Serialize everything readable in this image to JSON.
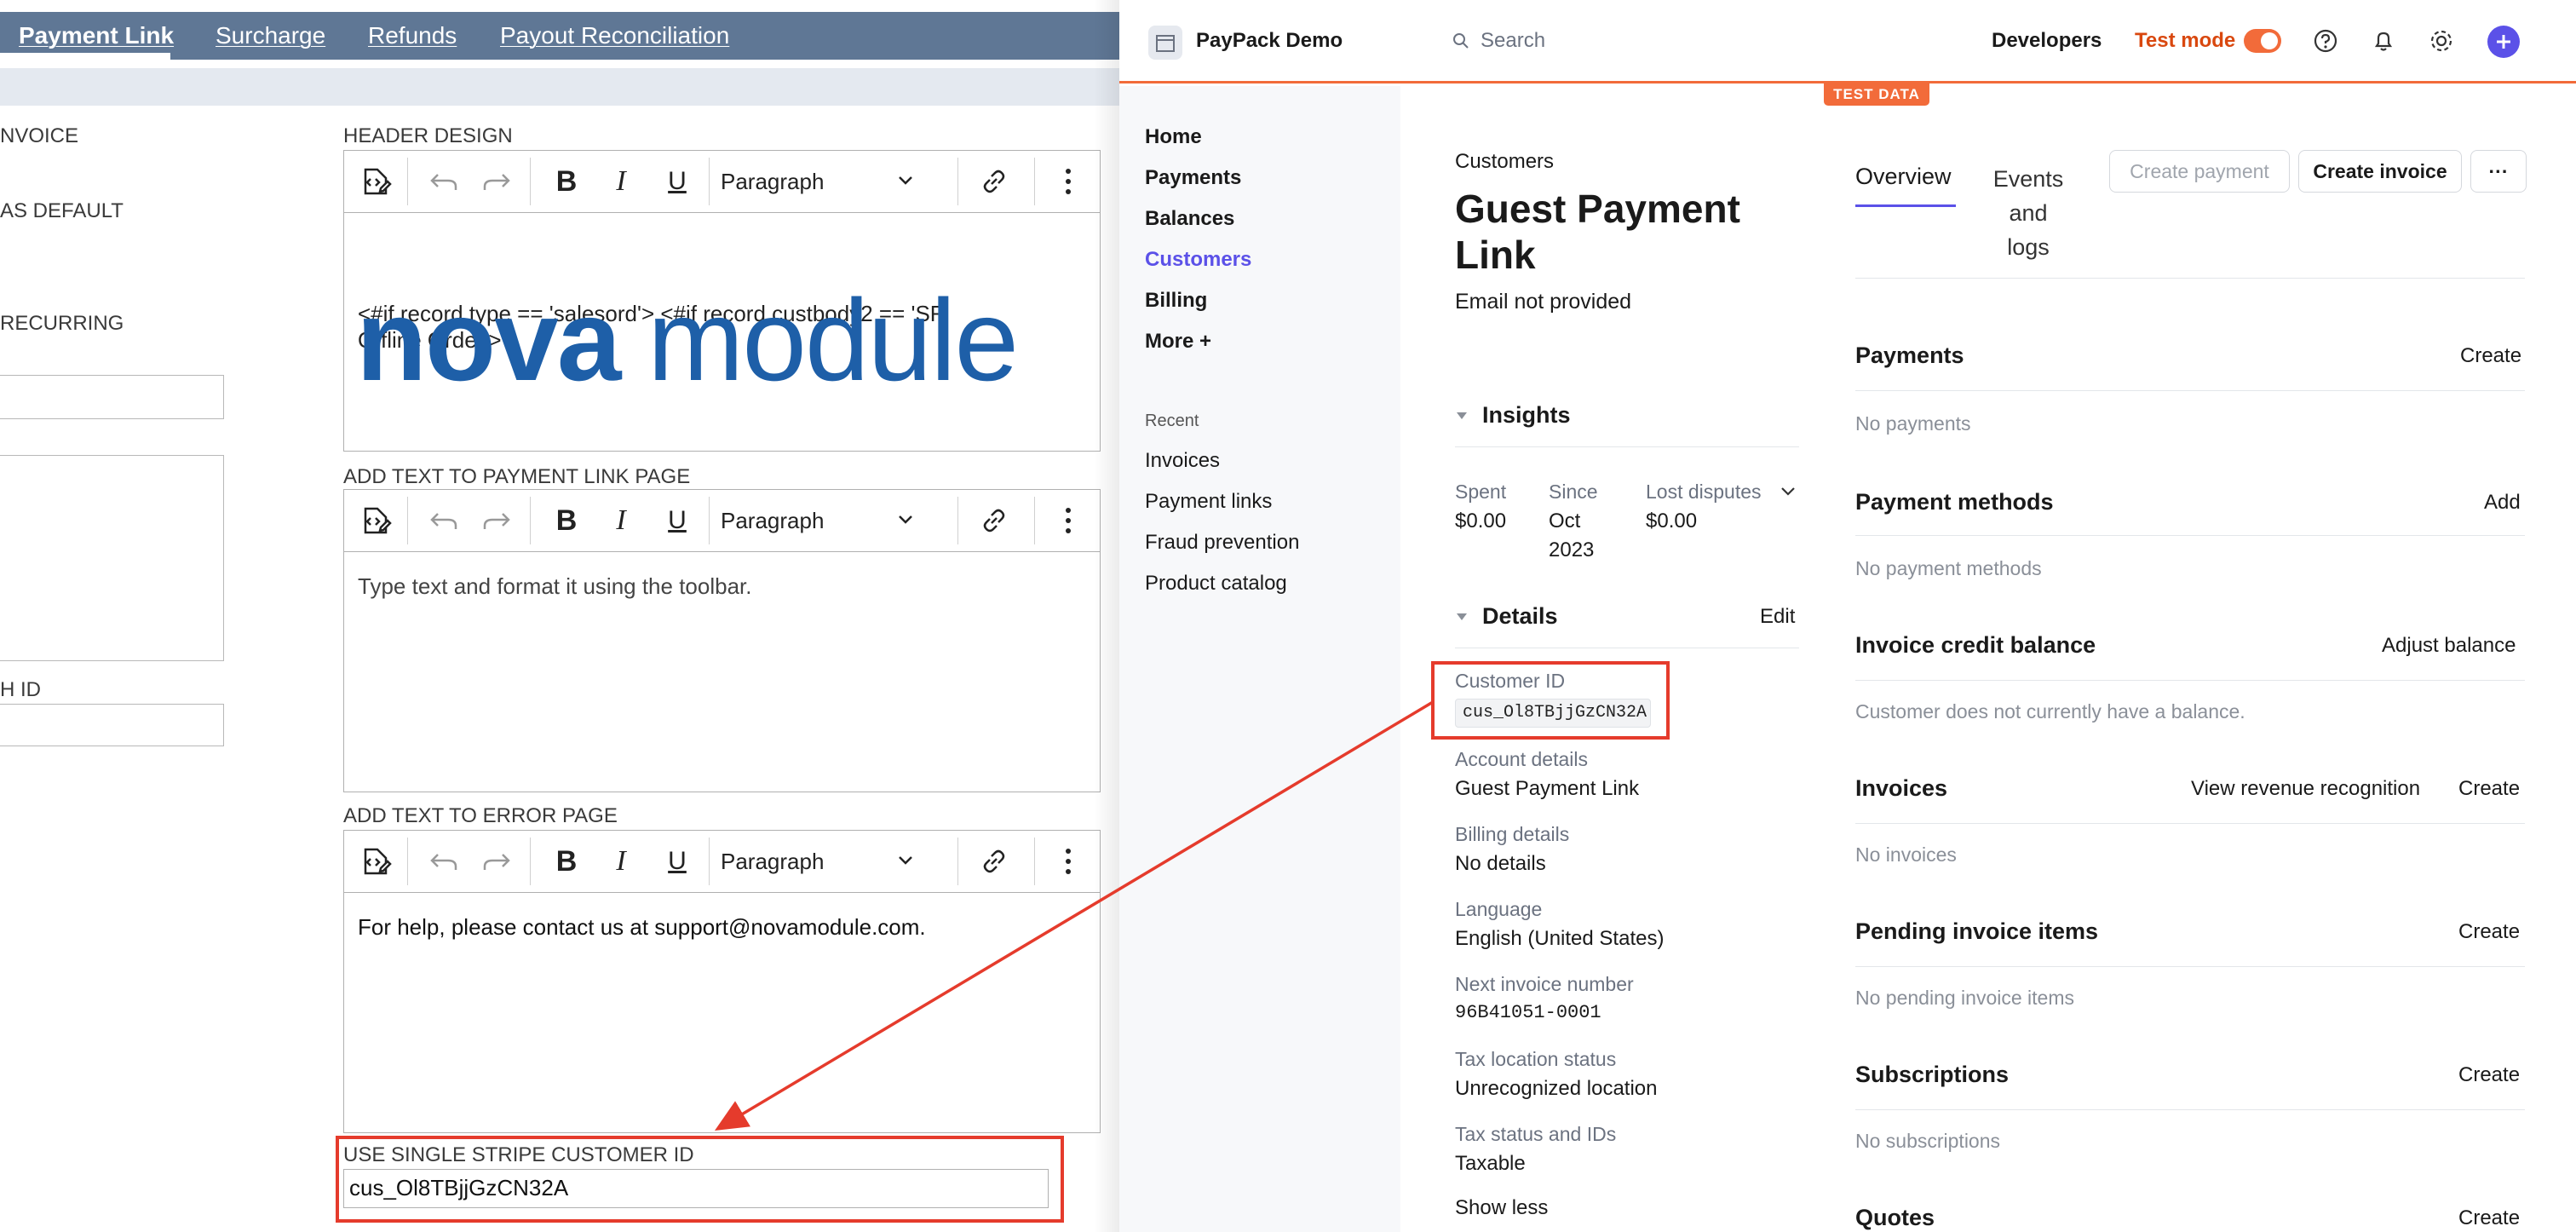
{
  "netsuite": {
    "tabs": [
      "Payment Link",
      "Surcharge",
      "Refunds",
      "Payout Reconciliation"
    ],
    "left_labels": [
      "NVOICE",
      "AS DEFAULT",
      "RECURRING",
      "H ID"
    ],
    "header_design_label": "HEADER DESIGN",
    "payment_link_page_label": "ADD TEXT TO PAYMENT LINK PAGE",
    "error_page_label": "ADD TEXT TO ERROR PAGE",
    "paragraph_option": "Paragraph",
    "header_text": "<#if record.type == 'salesord'> <#if record.custbody2 == 'SF Offline Order'>",
    "logo_part1": "nova",
    "logo_part2": "module",
    "logo_color": "#1e5fa8",
    "payment_link_placeholder": "Type text and format it using the toolbar.",
    "error_page_text": "For help, please contact us at support@novamodule.com.",
    "single_customer_label": "USE SINGLE STRIPE CUSTOMER ID",
    "single_customer_value": "cus_Ol8TBjjGzCN32A"
  },
  "stripe": {
    "account_name": "PayPack Demo",
    "search_placeholder": "Search",
    "developers": "Developers",
    "test_mode": "Test mode",
    "test_mode_on": true,
    "test_data_badge": "TEST DATA",
    "accent_color": "#5b51e8",
    "test_color": "#f26b3a",
    "sidebar": {
      "items": [
        "Home",
        "Payments",
        "Balances",
        "Customers",
        "Billing",
        "More +"
      ],
      "recent_label": "Recent",
      "recent_items": [
        "Invoices",
        "Payment links",
        "Fraud prevention",
        "Product catalog"
      ]
    },
    "breadcrumb": "Customers",
    "customer_name_line1": "Guest Payment",
    "customer_name_line2": "Link",
    "email": "Email not provided",
    "tabs": {
      "overview": "Overview",
      "events_1": "Events",
      "events_2": "and",
      "events_3": "logs"
    },
    "buttons": {
      "create_payment": "Create payment",
      "create_invoice": "Create invoice",
      "more": "···"
    },
    "insights": {
      "title": "Insights",
      "spent_label": "Spent",
      "spent_value": "$0.00",
      "since_label": "Since",
      "since_value_1": "Oct",
      "since_value_2": "2023",
      "disputes_label": "Lost disputes",
      "disputes_value": "$0.00"
    },
    "details": {
      "title": "Details",
      "edit": "Edit",
      "customer_id_label": "Customer ID",
      "customer_id": "cus_Ol8TBjjGzCN32A",
      "account_details_label": "Account details",
      "account_details": "Guest Payment Link",
      "billing_details_label": "Billing details",
      "billing_details": "No details",
      "language_label": "Language",
      "language": "English (United States)",
      "next_invoice_label": "Next invoice number",
      "next_invoice": "96B41051-0001",
      "tax_location_label": "Tax location status",
      "tax_location": "Unrecognized location",
      "tax_status_label": "Tax status and IDs",
      "tax_status": "Taxable",
      "show_less": "Show less"
    },
    "sections": {
      "payments": {
        "title": "Payments",
        "action": "Create",
        "empty": "No payments"
      },
      "payment_methods": {
        "title": "Payment methods",
        "action": "Add",
        "empty": "No payment methods"
      },
      "credit_balance": {
        "title": "Invoice credit balance",
        "action": "Adjust balance",
        "empty": "Customer does not currently have a balance."
      },
      "invoices": {
        "title": "Invoices",
        "action_1": "View revenue recognition",
        "action_2": "Create",
        "empty": "No invoices"
      },
      "pending": {
        "title": "Pending invoice items",
        "action": "Create",
        "empty": "No pending invoice items"
      },
      "subscriptions": {
        "title": "Subscriptions",
        "action": "Create",
        "empty": "No subscriptions"
      },
      "quotes": {
        "title": "Quotes",
        "action": "Create"
      }
    }
  }
}
